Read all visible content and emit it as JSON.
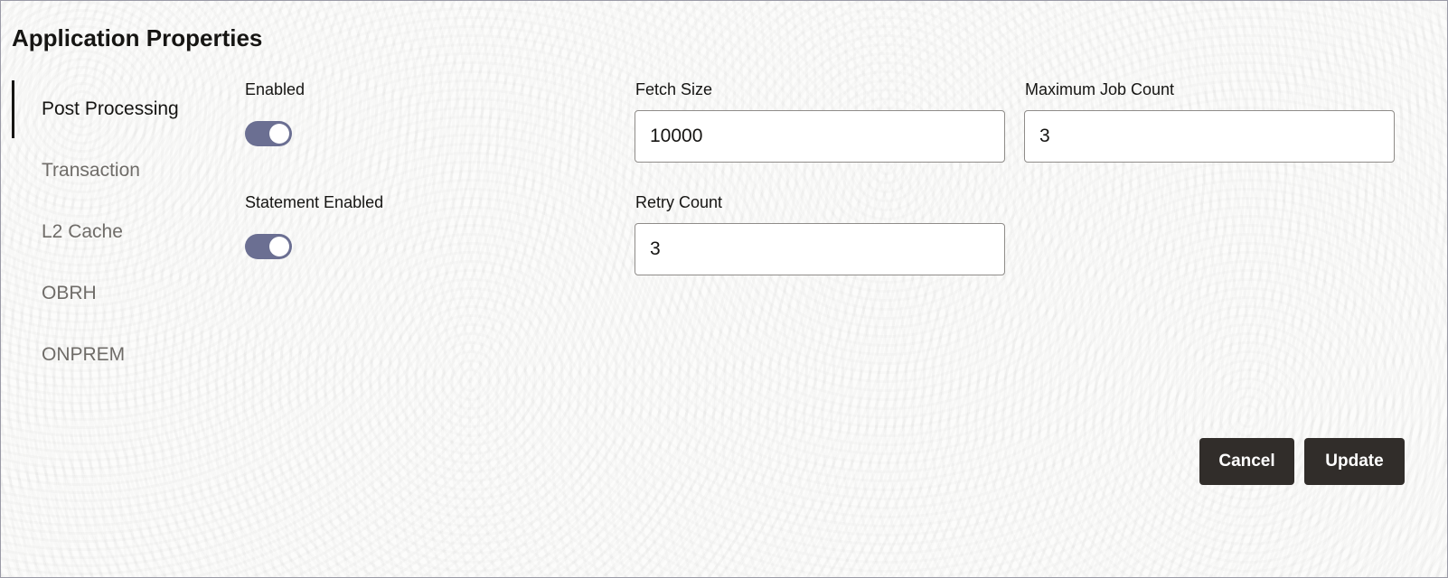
{
  "page": {
    "title": "Application Properties"
  },
  "nav": {
    "items": [
      {
        "label": "Post Processing",
        "active": true
      },
      {
        "label": "Transaction",
        "active": false
      },
      {
        "label": "L2 Cache",
        "active": false
      },
      {
        "label": "OBRH",
        "active": false
      },
      {
        "label": "ONPREM",
        "active": false
      }
    ]
  },
  "form": {
    "enabled": {
      "label": "Enabled",
      "value": true
    },
    "statement_enabled": {
      "label": "Statement Enabled",
      "value": true
    },
    "fetch_size": {
      "label": "Fetch Size",
      "value": "10000"
    },
    "retry_count": {
      "label": "Retry Count",
      "value": "3"
    },
    "max_job_count": {
      "label": "Maximum Job Count",
      "value": "3"
    }
  },
  "actions": {
    "cancel_label": "Cancel",
    "update_label": "Update"
  },
  "colors": {
    "toggle_on": "#6b6f92",
    "button_bg": "#312d2a",
    "active_indicator": "#161513"
  }
}
